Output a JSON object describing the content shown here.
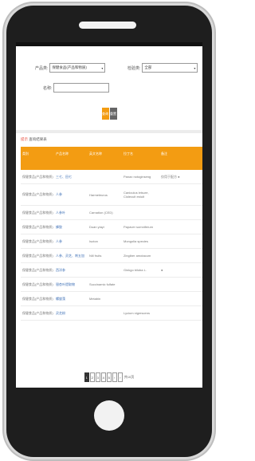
{
  "form": {
    "field1_label": "产品类:",
    "field1_value": "保健食品(产品和物质)",
    "field2_label": "检验类:",
    "field2_value": "全部",
    "field3_label": "名称:",
    "field3_value": "",
    "query_button": "查询",
    "reset_button": "重置"
  },
  "results": {
    "accent": "提示",
    "title": "查询结果表"
  },
  "table": {
    "headers": [
      "类别",
      "产品名称",
      "英文名称",
      "拉丁名",
      "备注"
    ],
    "rows": [
      [
        "保健食品(产品和物质)",
        "三七、田七",
        "",
        "Panax notoginseng",
        "仅用于配方 ●"
      ],
      [
        "保健食品(产品和物质)",
        "人参",
        "Harmeleurus",
        "Caniculus leisure, Ciolecuit estult",
        ""
      ],
      [
        "保健食品(产品和物质)",
        "人参叶",
        "Carnation (CED)",
        "",
        ""
      ],
      [
        "保健食品(产品和物质)",
        "蜂胶",
        "Duan yiayi",
        "Papaver somniferum",
        ""
      ],
      [
        "保健食品(产品和物质)",
        "人参",
        "Isoton",
        "Mongolia species",
        ""
      ],
      [
        "保健食品(产品和物质)",
        "人参、灵芝、刺五加",
        "Nill fruits",
        "Zingiber amotacum",
        ""
      ],
      [
        "保健食品(产品和物质)",
        "西洋参",
        "",
        "Ginkgo biloba L.",
        "●"
      ],
      [
        "保健食品(产品和物质)",
        "银杏叶提取物",
        "Succinamic fulfate",
        "",
        ""
      ],
      [
        "保健食品(产品和物质)",
        "螺旋藻",
        "Metabin",
        "",
        ""
      ],
      [
        "保健食品(产品和物质)",
        "灵芝粉",
        "",
        "Lycium nigrescens",
        ""
      ]
    ]
  },
  "pagination": {
    "pages": [
      "1",
      "2",
      "3",
      "4",
      "5"
    ],
    "next": "›",
    "last": "›",
    "total_label": "共10页"
  }
}
